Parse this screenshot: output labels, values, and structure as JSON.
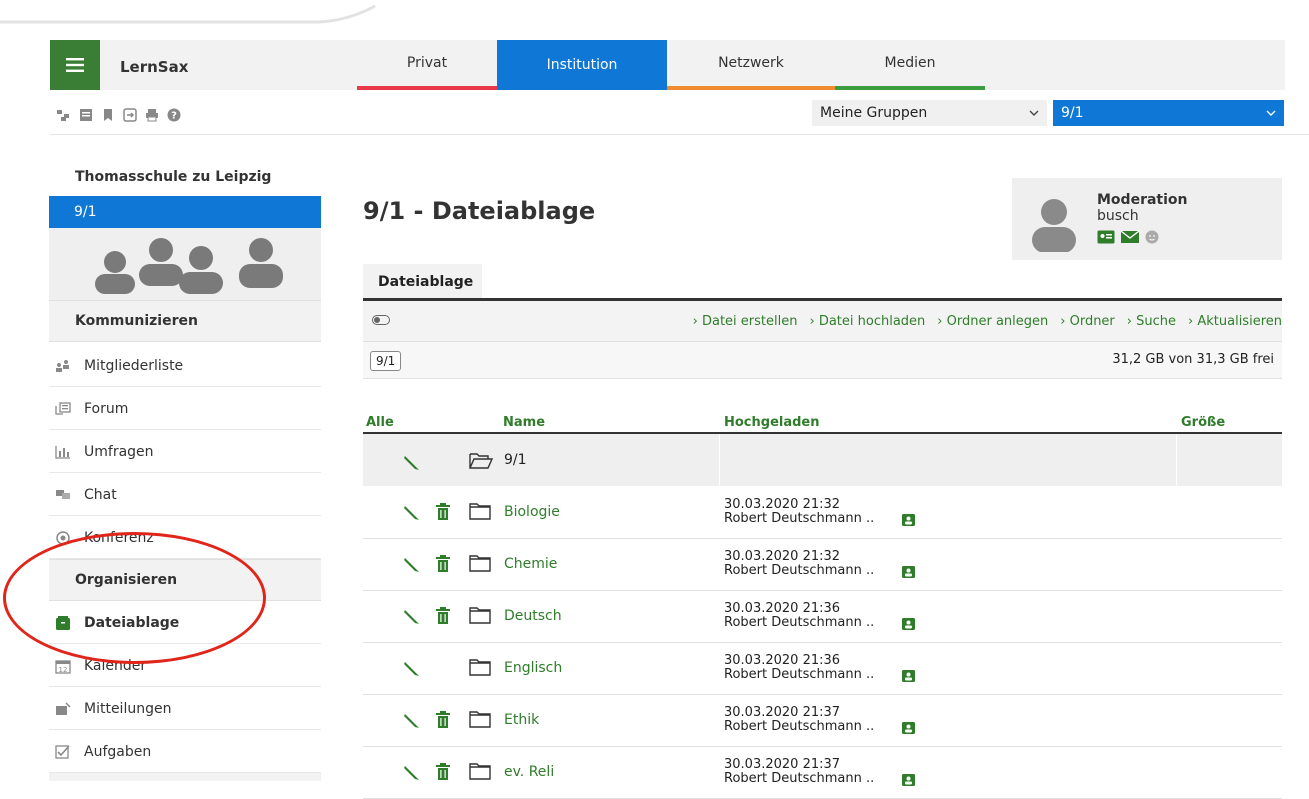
{
  "app": {
    "brand": "LernSax"
  },
  "nav": {
    "tabs": [
      {
        "label": "Privat",
        "color": "#e8394b"
      },
      {
        "label": "Institution",
        "color": "#0f78d6",
        "active": true
      },
      {
        "label": "Netzwerk",
        "color": "#f08b2e"
      },
      {
        "label": "Medien",
        "color": "#3a9d3f"
      }
    ]
  },
  "toolbar_icons": [
    "tree-icon",
    "note-icon",
    "bookmark-icon",
    "logout-icon",
    "print-icon",
    "help-icon"
  ],
  "selects": {
    "groups": "Meine Gruppen",
    "class": "9/1"
  },
  "sidebar": {
    "school": "Thomasschule zu Leipzig",
    "active_group": "9/1",
    "sections": [
      {
        "title": "Kommunizieren",
        "items": [
          {
            "label": "Mitgliederliste",
            "icon": "members-icon"
          },
          {
            "label": "Forum",
            "icon": "forum-icon"
          },
          {
            "label": "Umfragen",
            "icon": "chart-icon"
          },
          {
            "label": "Chat",
            "icon": "chat-icon"
          },
          {
            "label": "Konferenz",
            "icon": "headset-icon"
          }
        ]
      },
      {
        "title": "Organisieren",
        "items": [
          {
            "label": "Dateiablage",
            "icon": "file-box-icon",
            "selected": true
          },
          {
            "label": "Kalender",
            "icon": "calendar-icon"
          },
          {
            "label": "Mitteilungen",
            "icon": "message-icon"
          },
          {
            "label": "Aufgaben",
            "icon": "checkbox-icon"
          }
        ]
      }
    ]
  },
  "main": {
    "title": "9/1 - Dateiablage",
    "moderation": {
      "title": "Moderation",
      "user": "busch"
    },
    "subtab": "Dateiablage",
    "actions": [
      "Datei erstellen",
      "Datei hochladen",
      "Ordner anlegen",
      "Ordner",
      "Suche",
      "Aktualisieren"
    ],
    "path": "9/1",
    "quota": "31,2 GB von 31,3 GB frei",
    "columns": {
      "all": "Alle",
      "name": "Name",
      "uploaded": "Hochgeladen",
      "size": "Größe"
    },
    "parent_folder": "9/1",
    "rows": [
      {
        "name": "Biologie",
        "date": "30.03.2020 21:32",
        "user": "Robert Deutschmann ..",
        "deletable": true
      },
      {
        "name": "Chemie",
        "date": "30.03.2020 21:32",
        "user": "Robert Deutschmann ..",
        "deletable": true
      },
      {
        "name": "Deutsch",
        "date": "30.03.2020 21:36",
        "user": "Robert Deutschmann ..",
        "deletable": true
      },
      {
        "name": "Englisch",
        "date": "30.03.2020 21:36",
        "user": "Robert Deutschmann ..",
        "deletable": false
      },
      {
        "name": "Ethik",
        "date": "30.03.2020 21:37",
        "user": "Robert Deutschmann ..",
        "deletable": true
      },
      {
        "name": "ev. Reli",
        "date": "30.03.2020 21:37",
        "user": "Robert Deutschmann ..",
        "deletable": true
      }
    ]
  },
  "colors": {
    "green": "#2f7d2a",
    "blue": "#0f78d6",
    "annotation_red": "#e0261b"
  }
}
